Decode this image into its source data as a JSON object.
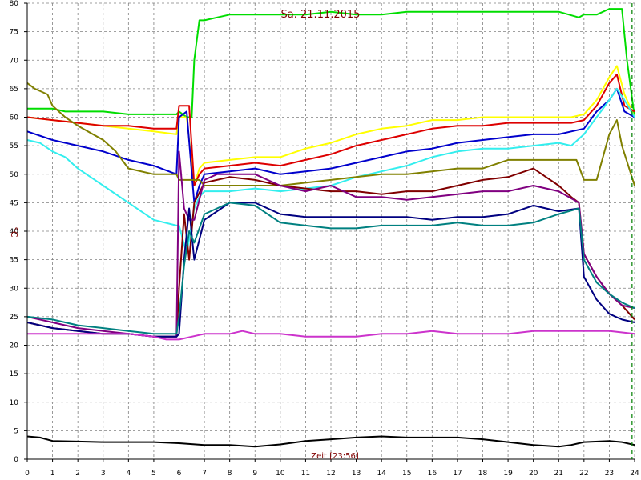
{
  "chart_data": {
    "type": "line",
    "title": "Sa. 21.11.2015",
    "xlabel": "Zeit [23:56]",
    "ylabel": "°C",
    "xlim": [
      0,
      24
    ],
    "ylim": [
      0,
      80
    ],
    "xticks": [
      0,
      1,
      2,
      3,
      4,
      5,
      6,
      7,
      8,
      9,
      10,
      11,
      12,
      13,
      14,
      15,
      16,
      17,
      18,
      19,
      20,
      21,
      22,
      23,
      24
    ],
    "yticks": [
      0,
      5,
      10,
      15,
      20,
      25,
      30,
      35,
      40,
      45,
      50,
      55,
      60,
      65,
      70,
      75,
      80
    ],
    "grid": true,
    "marker_x": 23.9,
    "series": [
      {
        "color": "#00dd00",
        "x": [
          0,
          0.5,
          1,
          1.5,
          2,
          3,
          4,
          5,
          5.9,
          6,
          6.3,
          6.5,
          6.6,
          6.8,
          7,
          7.5,
          8,
          9,
          10,
          11,
          12,
          13,
          14,
          15,
          16,
          17,
          18,
          19,
          20,
          21,
          21.8,
          22,
          22.5,
          23,
          23.3,
          23.5,
          23.7,
          24
        ],
        "y": [
          61.5,
          61.5,
          61.5,
          61,
          61,
          61,
          60.5,
          60.5,
          60.5,
          61,
          60,
          60,
          70,
          77,
          77,
          77.5,
          78,
          78,
          78,
          78,
          78.5,
          78,
          78,
          78.5,
          78.5,
          78.5,
          78.5,
          78.5,
          78.5,
          78.5,
          77.5,
          78,
          78,
          79,
          79,
          79,
          70,
          60
        ]
      },
      {
        "color": "#ffff00",
        "x": [
          0,
          1,
          2,
          3,
          4,
          5,
          5.9,
          6,
          6.3,
          6.6,
          6.8,
          7,
          8,
          9,
          10,
          11,
          12,
          13,
          14,
          15,
          16,
          17,
          18,
          19,
          20,
          21,
          21.5,
          22,
          22.5,
          23,
          23.3,
          23.6,
          24
        ],
        "y": [
          60,
          59.5,
          59,
          58.5,
          58,
          57.5,
          57,
          60,
          60,
          48,
          51,
          52,
          52.5,
          53,
          53,
          54.5,
          55.5,
          57,
          58,
          58.5,
          59.5,
          59.5,
          60,
          60,
          60,
          60,
          60,
          60.5,
          63,
          67,
          69,
          64,
          60
        ]
      },
      {
        "color": "#dd0000",
        "x": [
          0,
          1,
          2,
          3,
          4,
          5,
          5.9,
          6,
          6.4,
          6.6,
          6.8,
          7,
          8,
          9,
          10,
          11,
          12,
          13,
          14,
          15,
          16,
          17,
          18,
          19,
          20,
          21,
          21.5,
          22,
          22.5,
          23,
          23.3,
          23.6,
          24
        ],
        "y": [
          60,
          59.5,
          59,
          58.5,
          58.5,
          58,
          58,
          62,
          62,
          48,
          50,
          51,
          51.5,
          52,
          51.5,
          52.5,
          53.5,
          55,
          56,
          57,
          58,
          58.5,
          58.5,
          59,
          59,
          59,
          59,
          59.5,
          62,
          66,
          67.5,
          62,
          61
        ]
      },
      {
        "color": "#0000cc",
        "x": [
          0,
          1,
          2,
          3,
          4,
          5,
          5.9,
          6,
          6.3,
          6.6,
          6.8,
          7,
          8,
          9,
          10,
          11,
          12,
          13,
          14,
          15,
          16,
          17,
          18,
          19,
          20,
          21,
          21.5,
          22,
          22.5,
          23,
          23.3,
          23.6,
          24
        ],
        "y": [
          57.5,
          56,
          55,
          54,
          52.5,
          51.5,
          50,
          60,
          61,
          45,
          48,
          50,
          50.5,
          51,
          50,
          50.5,
          51,
          52,
          53,
          54,
          54.5,
          55.5,
          56,
          56.5,
          57,
          57,
          57.5,
          58,
          61,
          63,
          65,
          61,
          60
        ]
      },
      {
        "color": "#33eeee",
        "x": [
          0,
          0.5,
          1,
          1.5,
          2,
          3,
          4,
          5,
          5.9,
          6,
          6.3,
          6.6,
          6.8,
          7,
          8,
          9,
          10,
          11,
          12,
          13,
          14,
          15,
          16,
          17,
          18,
          19,
          20,
          21,
          21.5,
          22,
          22.5,
          23,
          23.3,
          23.6,
          24
        ],
        "y": [
          56,
          55.5,
          54,
          53,
          51,
          48,
          45,
          42,
          41,
          41,
          36,
          44,
          46,
          47,
          47,
          47.5,
          47,
          47.5,
          48,
          49.5,
          50.5,
          51.5,
          53,
          54,
          54.5,
          54.5,
          55,
          55.5,
          55,
          57,
          60,
          63,
          65,
          63,
          60
        ]
      },
      {
        "color": "#808000",
        "x": [
          0,
          0.3,
          0.8,
          1,
          1.5,
          2,
          3,
          3.5,
          4,
          5,
          5.9,
          6,
          6.3,
          6.6,
          6.8,
          7,
          8,
          9,
          10,
          11,
          12,
          13,
          14,
          15,
          16,
          17,
          18,
          19,
          20,
          21,
          21.7,
          22,
          22.5,
          23,
          23.3,
          23.5,
          24
        ],
        "y": [
          66,
          65,
          64,
          62,
          60,
          58.5,
          56,
          54,
          51,
          50,
          50,
          49,
          49,
          49,
          49,
          48,
          48,
          48,
          48,
          48.5,
          49,
          49.5,
          50,
          50,
          50.5,
          51,
          51,
          52.5,
          52.5,
          52.5,
          52.5,
          49,
          49,
          57,
          59.5,
          55,
          48
        ]
      },
      {
        "color": "#800000",
        "x": [
          0,
          1,
          2,
          3,
          4,
          5,
          5.9,
          6,
          6.2,
          6.4,
          6.6,
          7,
          8,
          9,
          10,
          11,
          12,
          13,
          14,
          15,
          16,
          17,
          18,
          19,
          20,
          20.5,
          21,
          21.5,
          21.8,
          22,
          22.5,
          23,
          23.5,
          24
        ],
        "y": [
          24,
          23,
          22.5,
          22,
          22,
          21.5,
          21.5,
          30,
          43,
          35,
          45,
          48.5,
          49.5,
          49,
          48,
          47.5,
          47,
          47,
          46.5,
          47,
          47,
          48,
          49,
          49.5,
          51,
          49.5,
          48,
          46,
          45,
          36,
          32,
          29,
          27,
          24.5
        ]
      },
      {
        "color": "#800080",
        "x": [
          0,
          1,
          2,
          3,
          4,
          5,
          5.9,
          6,
          6.2,
          6.4,
          6.6,
          7,
          7.5,
          8,
          9,
          10,
          11,
          12,
          13,
          14,
          15,
          16,
          17,
          18,
          19,
          20,
          21,
          21.8,
          22,
          22.5,
          23,
          23.5,
          24
        ],
        "y": [
          25,
          24,
          23,
          22.5,
          22,
          21.5,
          21.5,
          54,
          44,
          42,
          42,
          49,
          50,
          50,
          50,
          48,
          47,
          48,
          46,
          46,
          45.5,
          46,
          46.5,
          47,
          47,
          48,
          47,
          45,
          36,
          32,
          29,
          27,
          26.5
        ]
      },
      {
        "color": "#000080",
        "x": [
          0,
          1,
          2,
          3,
          4,
          5,
          5.9,
          6,
          6.2,
          6.4,
          6.6,
          7,
          8,
          9,
          10,
          11,
          12,
          13,
          14,
          15,
          16,
          17,
          18,
          19,
          20,
          21,
          21.8,
          22,
          22.5,
          23,
          23.5,
          24
        ],
        "y": [
          24,
          23,
          22.5,
          22,
          22,
          21.5,
          21.5,
          22,
          35,
          44,
          35,
          42,
          45,
          45,
          43,
          42.5,
          42.5,
          42.5,
          42.5,
          42.5,
          42,
          42.5,
          42.5,
          43,
          44.5,
          43.5,
          44,
          32,
          28,
          25.5,
          24.5,
          24
        ]
      },
      {
        "color": "#008080",
        "x": [
          0,
          1,
          2,
          3,
          4,
          5,
          5.9,
          6,
          6.2,
          6.4,
          6.6,
          7,
          8,
          9,
          10,
          11,
          12,
          13,
          14,
          15,
          16,
          17,
          18,
          19,
          20,
          21,
          21.8,
          22,
          22.5,
          23,
          23.5,
          24
        ],
        "y": [
          25,
          24.5,
          23.5,
          23,
          22.5,
          22,
          22,
          25,
          34,
          40,
          38,
          43,
          45,
          44.5,
          41.5,
          41,
          40.5,
          40.5,
          41,
          41,
          41,
          41.5,
          41,
          41,
          41.5,
          43,
          44,
          35,
          31,
          29,
          27.5,
          26.5
        ]
      },
      {
        "color": "#cc33cc",
        "x": [
          0,
          1,
          2,
          3,
          4,
          5,
          5.5,
          6,
          6.5,
          7,
          8,
          8.5,
          9,
          10,
          11,
          12,
          13,
          14,
          15,
          16,
          17,
          18,
          19,
          20,
          21,
          22,
          23,
          24
        ],
        "y": [
          22,
          22,
          22,
          22,
          22,
          21.5,
          21,
          21,
          21.5,
          22,
          22,
          22.5,
          22,
          22,
          21.5,
          21.5,
          21.5,
          22,
          22,
          22.5,
          22,
          22,
          22,
          22.5,
          22.5,
          22.5,
          22.5,
          22
        ]
      },
      {
        "color": "#000000",
        "x": [
          0,
          0.5,
          1,
          2,
          3,
          4,
          5,
          6,
          7,
          8,
          9,
          10,
          11,
          12,
          13,
          14,
          15,
          16,
          17,
          18,
          19,
          20,
          21,
          21.5,
          22,
          23,
          23.5,
          24
        ],
        "y": [
          4,
          3.8,
          3.2,
          3.1,
          3,
          3,
          3,
          2.8,
          2.5,
          2.5,
          2.2,
          2.6,
          3.2,
          3.5,
          3.8,
          4,
          3.8,
          3.8,
          3.8,
          3.5,
          3,
          2.5,
          2.2,
          2.5,
          3,
          3.2,
          3,
          2.5
        ]
      }
    ]
  }
}
